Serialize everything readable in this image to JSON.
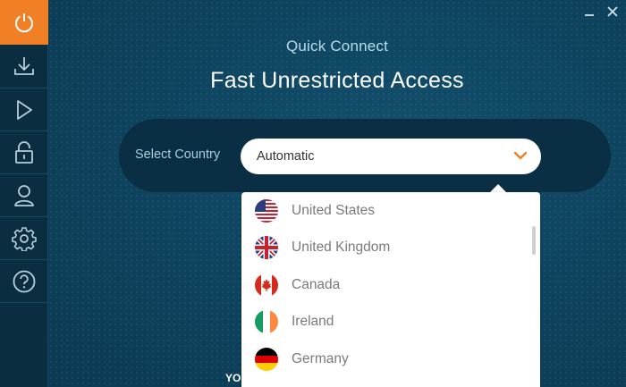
{
  "window": {
    "minimize_icon": "minimize-icon",
    "close_icon": "close-icon"
  },
  "sidebar": {
    "items": [
      {
        "name": "power",
        "icon": "power-icon",
        "active": true
      },
      {
        "name": "download",
        "icon": "download-icon"
      },
      {
        "name": "play",
        "icon": "play-icon"
      },
      {
        "name": "lock",
        "icon": "lock-icon"
      },
      {
        "name": "account",
        "icon": "user-icon"
      },
      {
        "name": "settings",
        "icon": "gear-icon"
      },
      {
        "name": "help",
        "icon": "help-icon"
      }
    ]
  },
  "main": {
    "subtitle": "Quick Connect",
    "title": "Fast Unrestricted Access",
    "select_label": "Select Country",
    "select_value": "Automatic",
    "bottom_text": "YO"
  },
  "countries": [
    {
      "name": "United States",
      "flag": "us-flag"
    },
    {
      "name": "United Kingdom",
      "flag": "uk-flag"
    },
    {
      "name": "Canada",
      "flag": "canada-flag"
    },
    {
      "name": "Ireland",
      "flag": "ireland-flag"
    },
    {
      "name": "Germany",
      "flag": "germany-flag"
    }
  ],
  "colors": {
    "accent": "#f07f26",
    "background": "#0f4560",
    "sidebar": "#0b2d40"
  }
}
